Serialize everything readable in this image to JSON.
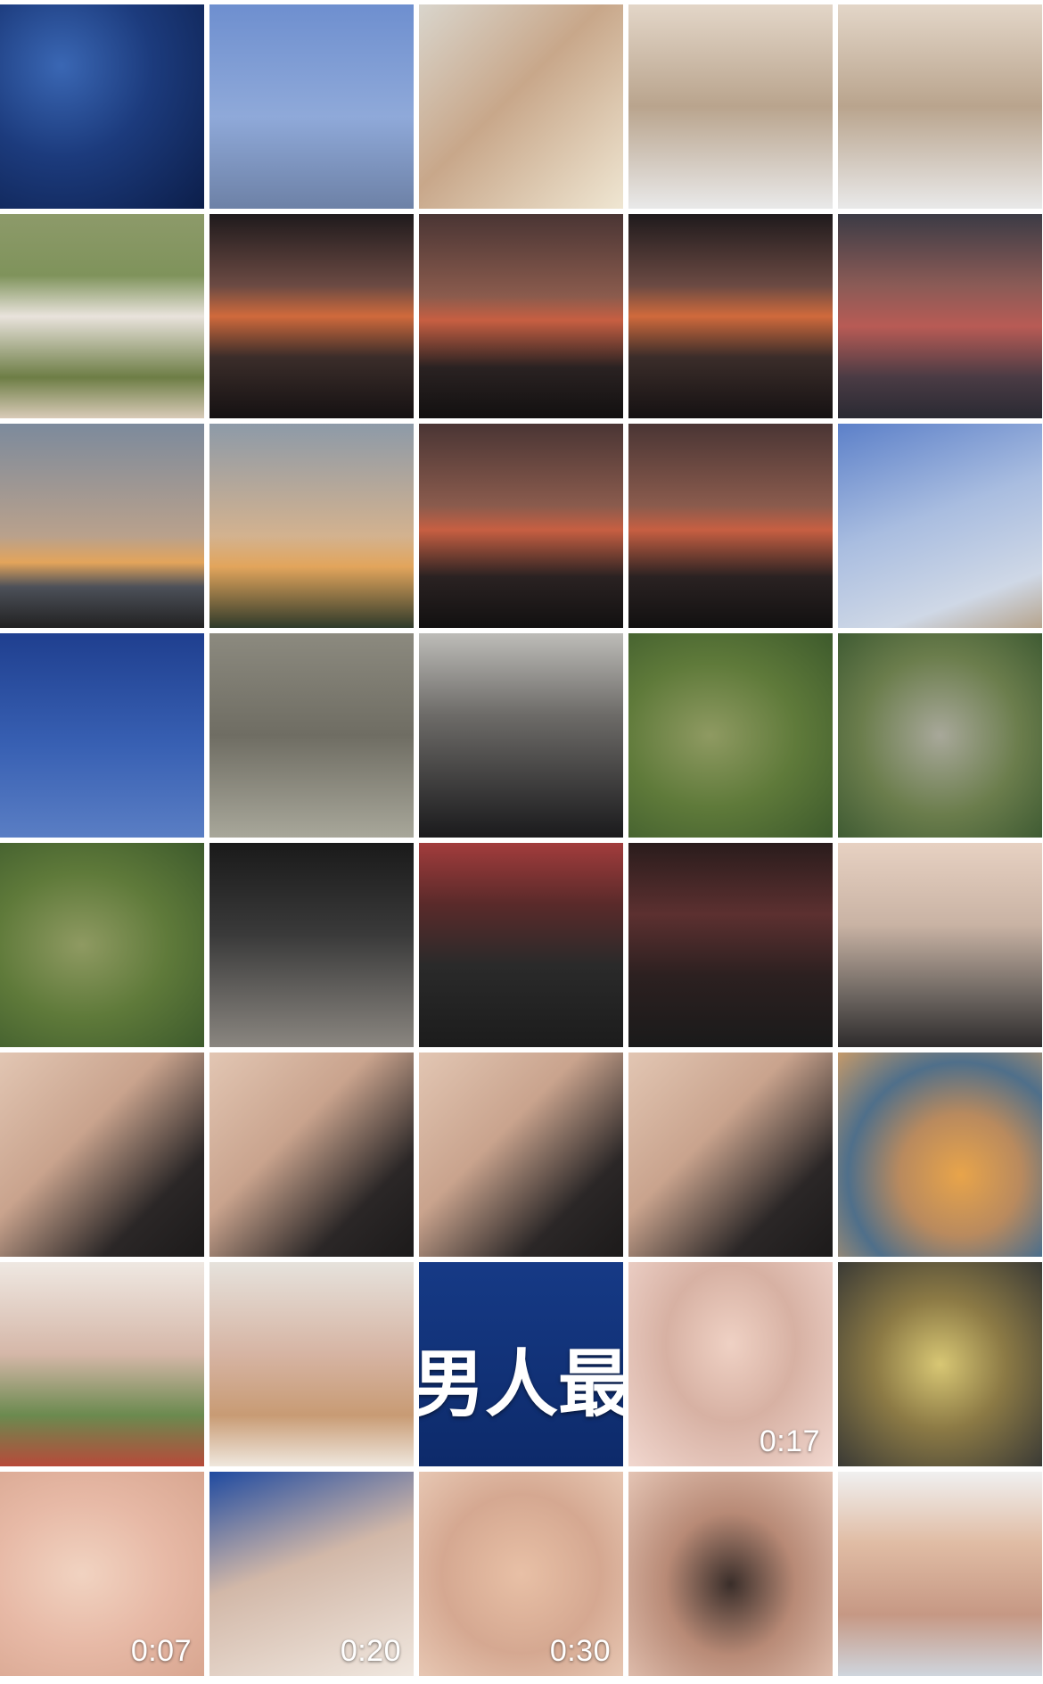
{
  "gallery": {
    "items": [
      {
        "theme": "t-night",
        "icon": "starry-sky-photo"
      },
      {
        "theme": "t-night2",
        "icon": "night-sky-person-photo"
      },
      {
        "theme": "t-arm",
        "icon": "arm-photo"
      },
      {
        "theme": "t-store",
        "icon": "store-mirror-selfie-photo"
      },
      {
        "theme": "t-store",
        "icon": "store-mirror-selfie-photo"
      },
      {
        "theme": "t-collage",
        "icon": "couple-collage-photo"
      },
      {
        "theme": "t-sunset",
        "icon": "sunset-dance-photo"
      },
      {
        "theme": "t-sunset2",
        "icon": "sunset-silhouette-photo"
      },
      {
        "theme": "t-sunset",
        "icon": "sunset-couple-photo"
      },
      {
        "theme": "t-sunset3",
        "icon": "sunset-sea-collage-photo"
      },
      {
        "theme": "t-dusk",
        "icon": "sunset-drone-photo"
      },
      {
        "theme": "t-dusk2",
        "icon": "sunset-tower-photo"
      },
      {
        "theme": "t-sunset2",
        "icon": "sunset-dance-photo"
      },
      {
        "theme": "t-sunset2",
        "icon": "sunset-dance-photo"
      },
      {
        "theme": "t-sky",
        "icon": "sky-person-photo"
      },
      {
        "theme": "t-night3",
        "icon": "starry-sky-photo"
      },
      {
        "theme": "t-rock",
        "icon": "couple-on-rocks-photo"
      },
      {
        "theme": "t-selfie",
        "icon": "masked-selfie-photo"
      },
      {
        "theme": "t-aerial",
        "icon": "aerial-island-photo"
      },
      {
        "theme": "t-aerial2",
        "icon": "aerial-island-photo"
      },
      {
        "theme": "t-aerial",
        "icon": "aerial-collage-photo"
      },
      {
        "theme": "t-theater",
        "icon": "cinema-feet-photo"
      },
      {
        "theme": "t-theater2",
        "icon": "cinema-screen-photo"
      },
      {
        "theme": "t-theater3",
        "icon": "cinema-screen-photo"
      },
      {
        "theme": "t-massage",
        "icon": "foot-massage-photo"
      },
      {
        "theme": "t-room",
        "icon": "massage-room-photo"
      },
      {
        "theme": "t-room",
        "icon": "massage-room-selfie-photo"
      },
      {
        "theme": "t-room",
        "icon": "massage-room-selfie-photo"
      },
      {
        "theme": "t-room",
        "icon": "massage-room-photo"
      },
      {
        "theme": "t-food",
        "icon": "dessert-table-photo"
      },
      {
        "theme": "t-girl",
        "icon": "girl-dessert-photo"
      },
      {
        "theme": "t-girl2",
        "icon": "girl-smiling-photo"
      },
      {
        "theme": "t-blue",
        "icon": "text-video-thumbnail",
        "overlay": "男人最"
      },
      {
        "theme": "t-face",
        "icon": "face-video-thumbnail",
        "duration": "0:17"
      },
      {
        "theme": "t-soup",
        "icon": "soup-pot-photo"
      },
      {
        "theme": "t-skin",
        "icon": "closeup-video-thumbnail",
        "duration": "0:07"
      },
      {
        "theme": "t-bed",
        "icon": "bed-video-thumbnail",
        "duration": "0:20"
      },
      {
        "theme": "t-skin2",
        "icon": "closeup-video-thumbnail",
        "duration": "0:30"
      },
      {
        "theme": "t-hair",
        "icon": "closeup-photo"
      },
      {
        "theme": "t-boy",
        "icon": "boy-selfie-photo"
      }
    ]
  }
}
